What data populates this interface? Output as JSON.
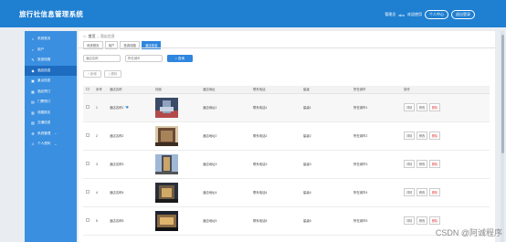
{
  "header": {
    "app_title": "旅行社信息管理系统",
    "user_role": "管理员",
    "username": "abo",
    "extra_text": "欢迎使用",
    "profile_label": "个人中心",
    "logout_label": "退出登录",
    "colors": {
      "topbar": "#1f7fd1",
      "sidebar": "#3a8fe0",
      "active": "#1e6cc0"
    }
  },
  "sidebar": {
    "items": [
      {
        "label": "系统首页",
        "icon": "home-icon"
      },
      {
        "label": "用户",
        "icon": "user-icon"
      },
      {
        "label": "旅游线路",
        "icon": "route-icon"
      },
      {
        "label": "酒店信息",
        "icon": "hotel-icon"
      },
      {
        "label": "景点信息",
        "icon": "scenic-icon"
      },
      {
        "label": "酒店预订",
        "icon": "booking-icon"
      },
      {
        "label": "门票预订",
        "icon": "ticket-icon"
      },
      {
        "label": "线路报名",
        "icon": "signup-icon"
      },
      {
        "label": "交通信息",
        "icon": "transport-icon"
      },
      {
        "label": "系统管理",
        "icon": "settings-icon"
      },
      {
        "label": "个人资料",
        "icon": "profile-icon"
      }
    ]
  },
  "breadcrumb": {
    "home": "首页",
    "current": "酒店信息"
  },
  "tags": [
    "系统首页",
    "用户",
    "旅游线路",
    "酒店信息"
  ],
  "search": {
    "name_placeholder": "酒店名称",
    "city_placeholder": "所在城市",
    "search_label": "查询"
  },
  "actions": {
    "add_label": "新增",
    "delete_label": "删除"
  },
  "table": {
    "columns": [
      "",
      "序号",
      "酒店名称",
      "封面",
      "酒店地址",
      "联系电话",
      "星级",
      "所在城市",
      "操作"
    ],
    "rows": [
      {
        "index": "1",
        "name": "酒店名称1",
        "addr": "酒店地址1",
        "phone": "联系电话1",
        "star": "星级1",
        "city": "所在城市1"
      },
      {
        "index": "2",
        "name": "酒店名称2",
        "addr": "酒店地址2",
        "phone": "联系电话2",
        "star": "星级2",
        "city": "所在城市2"
      },
      {
        "index": "3",
        "name": "酒店名称3",
        "addr": "酒店地址3",
        "phone": "联系电话3",
        "star": "星级3",
        "city": "所在城市3"
      },
      {
        "index": "4",
        "name": "酒店名称4",
        "addr": "酒店地址4",
        "phone": "联系电话4",
        "star": "星级4",
        "city": "所在城市4"
      },
      {
        "index": "5",
        "name": "酒店名称5",
        "addr": "酒店地址5",
        "phone": "联系电话5",
        "star": "星级5",
        "city": "所在城市5"
      }
    ],
    "op_labels": {
      "detail": "详情",
      "edit": "修改",
      "delete": "删除"
    }
  },
  "watermark": "CSDN @阿诚程序"
}
